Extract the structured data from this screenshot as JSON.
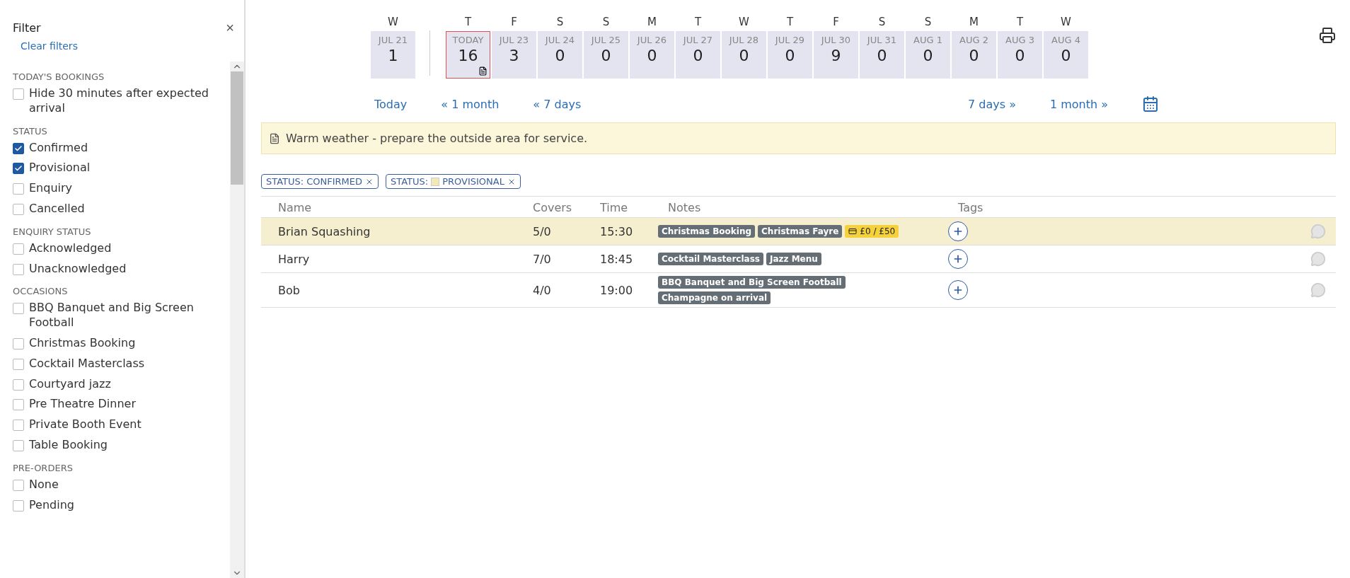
{
  "filter": {
    "title": "Filter",
    "close": "×",
    "clear": "Clear filters",
    "sections": [
      {
        "heading": "TODAY'S BOOKINGS",
        "options": [
          {
            "label": "Hide 30 minutes after expected arrival",
            "checked": false
          }
        ]
      },
      {
        "heading": "STATUS",
        "options": [
          {
            "label": "Confirmed",
            "checked": true
          },
          {
            "label": "Provisional",
            "checked": true
          },
          {
            "label": "Enquiry",
            "checked": false
          },
          {
            "label": "Cancelled",
            "checked": false
          }
        ]
      },
      {
        "heading": "ENQUIRY STATUS",
        "options": [
          {
            "label": "Acknowledged",
            "checked": false
          },
          {
            "label": "Unacknowledged",
            "checked": false
          }
        ]
      },
      {
        "heading": "OCCASIONS",
        "options": [
          {
            "label": "BBQ Banquet and Big Screen Football",
            "checked": false
          },
          {
            "label": "Christmas Booking",
            "checked": false
          },
          {
            "label": "Cocktail Masterclass",
            "checked": false
          },
          {
            "label": "Courtyard jazz",
            "checked": false
          },
          {
            "label": "Pre Theatre Dinner",
            "checked": false
          },
          {
            "label": "Private Booth Event",
            "checked": false
          },
          {
            "label": "Table Booking",
            "checked": false
          }
        ]
      },
      {
        "heading": "PRE-ORDERS",
        "options": [
          {
            "label": "None",
            "checked": false
          },
          {
            "label": "Pending",
            "checked": false
          }
        ]
      }
    ]
  },
  "days": [
    {
      "weekday": "W",
      "date": "JUL 21",
      "count": "1",
      "selected": false,
      "note": false
    },
    {
      "weekday": "T",
      "date": "TODAY",
      "count": "16",
      "selected": true,
      "note": true
    },
    {
      "weekday": "F",
      "date": "JUL 23",
      "count": "3",
      "selected": false,
      "note": false
    },
    {
      "weekday": "S",
      "date": "JUL 24",
      "count": "0",
      "selected": false,
      "note": false
    },
    {
      "weekday": "S",
      "date": "JUL 25",
      "count": "0",
      "selected": false,
      "note": false
    },
    {
      "weekday": "M",
      "date": "JUL 26",
      "count": "0",
      "selected": false,
      "note": false
    },
    {
      "weekday": "T",
      "date": "JUL 27",
      "count": "0",
      "selected": false,
      "note": false
    },
    {
      "weekday": "W",
      "date": "JUL 28",
      "count": "0",
      "selected": false,
      "note": false
    },
    {
      "weekday": "T",
      "date": "JUL 29",
      "count": "0",
      "selected": false,
      "note": false
    },
    {
      "weekday": "F",
      "date": "JUL 30",
      "count": "9",
      "selected": false,
      "note": false
    },
    {
      "weekday": "S",
      "date": "JUL 31",
      "count": "0",
      "selected": false,
      "note": false
    },
    {
      "weekday": "S",
      "date": "AUG 1",
      "count": "0",
      "selected": false,
      "note": false
    },
    {
      "weekday": "M",
      "date": "AUG 2",
      "count": "0",
      "selected": false,
      "note": false
    },
    {
      "weekday": "T",
      "date": "AUG 3",
      "count": "0",
      "selected": false,
      "note": false
    },
    {
      "weekday": "W",
      "date": "AUG 4",
      "count": "0",
      "selected": false,
      "note": false
    }
  ],
  "nav": {
    "left": [
      "Today",
      "« 1 month",
      "« 7 days"
    ],
    "right": [
      "7 days »",
      "1 month »"
    ]
  },
  "note": "Warm weather - prepare the outside area for service.",
  "active_filters": [
    {
      "prefix": "STATUS: ",
      "label": "CONFIRMED",
      "swatch": false
    },
    {
      "prefix": "STATUS: ",
      "label": "PROVISIONAL",
      "swatch": true
    }
  ],
  "table": {
    "columns": [
      "Name",
      "Covers",
      "Time",
      "Notes",
      "Tags"
    ],
    "rows": [
      {
        "name": "Brian Squashing",
        "covers": "5/0",
        "time": "15:30",
        "notes": [
          "Christmas Booking",
          "Christmas Fayre"
        ],
        "payment": "£0 / £50",
        "highlighted": true
      },
      {
        "name": "Harry",
        "covers": "7/0",
        "time": "18:45",
        "notes": [
          "Cocktail Masterclass",
          "Jazz Menu"
        ],
        "highlighted": false
      },
      {
        "name": "Bob",
        "covers": "4/0",
        "time": "19:00",
        "notes": [
          "BBQ Banquet and Big Screen Football",
          "Champagne on arrival"
        ],
        "highlighted": false
      }
    ]
  }
}
